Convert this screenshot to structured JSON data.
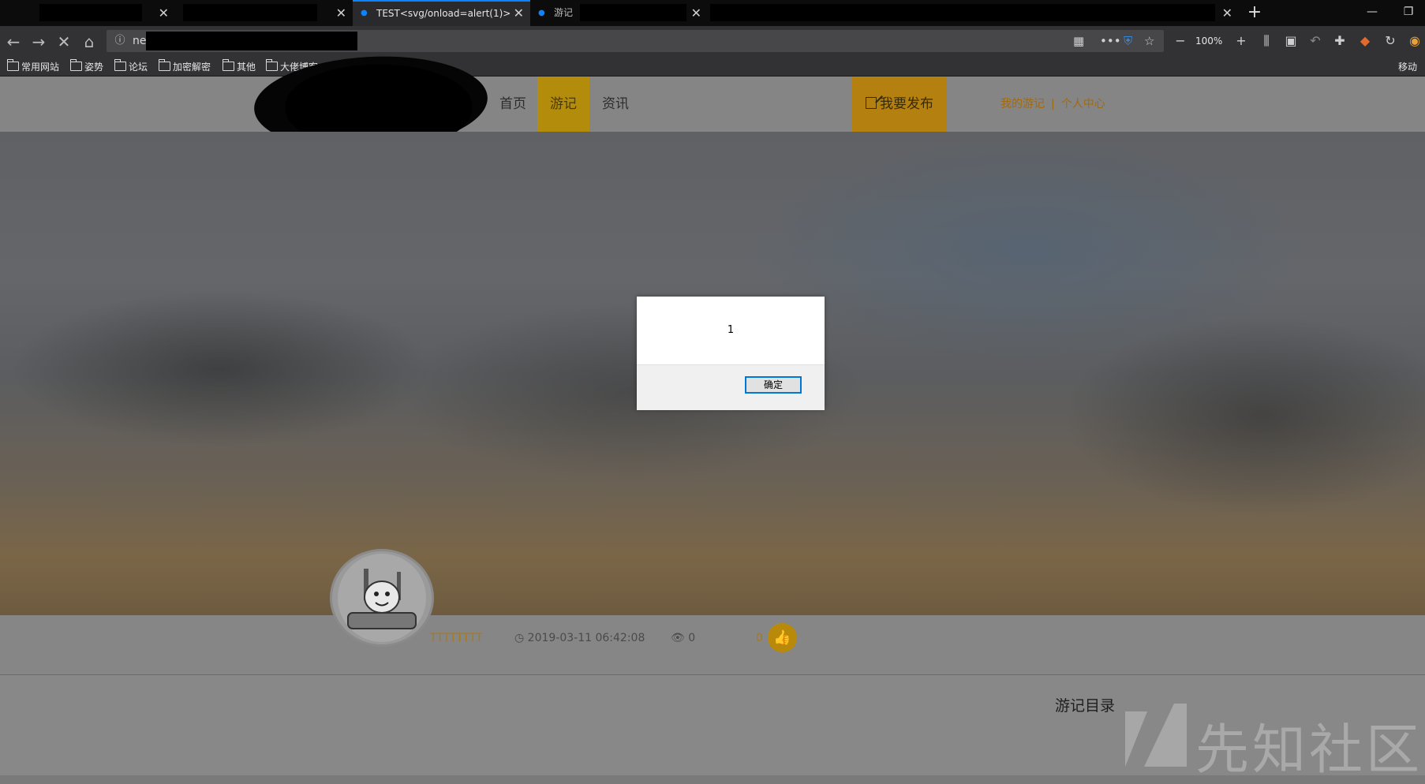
{
  "browser": {
    "tabs": [
      {
        "label": "",
        "active": false
      },
      {
        "label": "",
        "active": false
      },
      {
        "label": "TEST<svg/onload=alert(1)>",
        "active": true
      },
      {
        "label": "游记",
        "active": false
      },
      {
        "label": "",
        "active": false
      }
    ],
    "new_tab": "+",
    "address_visible": "ne",
    "zoom": "100%",
    "bookmarks": [
      "常用网站",
      "姿势",
      "论坛",
      "加密解密",
      "其他",
      "大佬博客"
    ],
    "mobile_bookmarks": "移动"
  },
  "site": {
    "nav": {
      "home": "首页",
      "travel": "游记",
      "news": "资讯"
    },
    "publish_label": "我要发布",
    "my_travel": "我的游记",
    "separator": "|",
    "user_center": "个人中心"
  },
  "post": {
    "author": "TTTTTTTT",
    "date": "2019-03-11 06:42:08",
    "views": "0",
    "likes": "0",
    "toc_title": "游记目录"
  },
  "alert": {
    "message": "1",
    "ok_label": "确定"
  },
  "watermark": "先知社区",
  "colors": {
    "accent": "#b48c0c",
    "link": "#a06a10",
    "tab_highlight": "#0a84ff"
  }
}
